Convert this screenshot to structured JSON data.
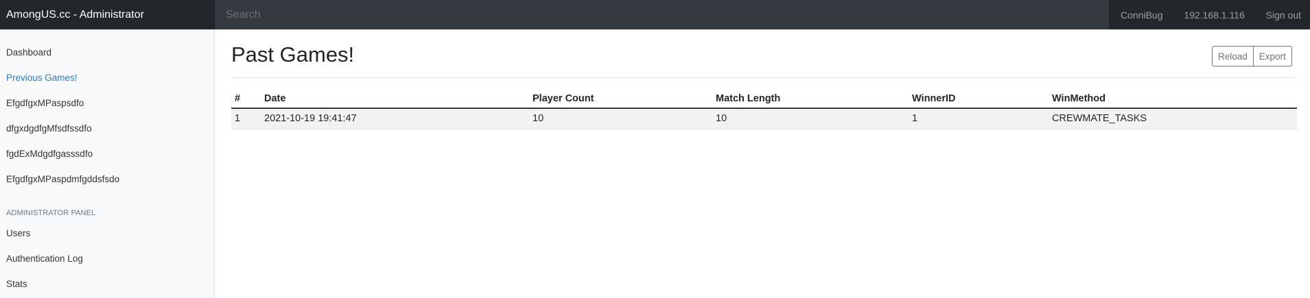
{
  "app": {
    "brand": "AmongUS.cc - Administrator"
  },
  "search": {
    "placeholder": "Search"
  },
  "nav": {
    "user": "ConniBug",
    "ip": "192.168.1.116",
    "signout": "Sign out"
  },
  "sidebar": {
    "items": [
      {
        "label": "Dashboard",
        "active": false
      },
      {
        "label": "Previous Games!",
        "active": true
      },
      {
        "label": "EfgdfgxMPaspsdfo",
        "active": false
      },
      {
        "label": "dfgxdgdfgMfsdfssdfo",
        "active": false
      },
      {
        "label": "fgdExMdgdfgasssdfo",
        "active": false
      },
      {
        "label": "EfgdfgxMPaspdmfgddsfsdo",
        "active": false
      }
    ],
    "admin_heading": "ADMINISTRATOR PANEL",
    "admin_items": [
      {
        "label": "Users"
      },
      {
        "label": "Authentication Log"
      },
      {
        "label": "Stats"
      }
    ]
  },
  "main": {
    "title": "Past Games!",
    "buttons": {
      "reload": "Reload",
      "export": "Export"
    },
    "table": {
      "columns": [
        "#",
        "Date",
        "Player Count",
        "Match Length",
        "WinnerID",
        "WinMethod"
      ],
      "rows": [
        [
          "1",
          "2021-10-19 19:41:47",
          "10",
          "10",
          "1",
          "CREWMATE_TASKS"
        ]
      ]
    }
  }
}
